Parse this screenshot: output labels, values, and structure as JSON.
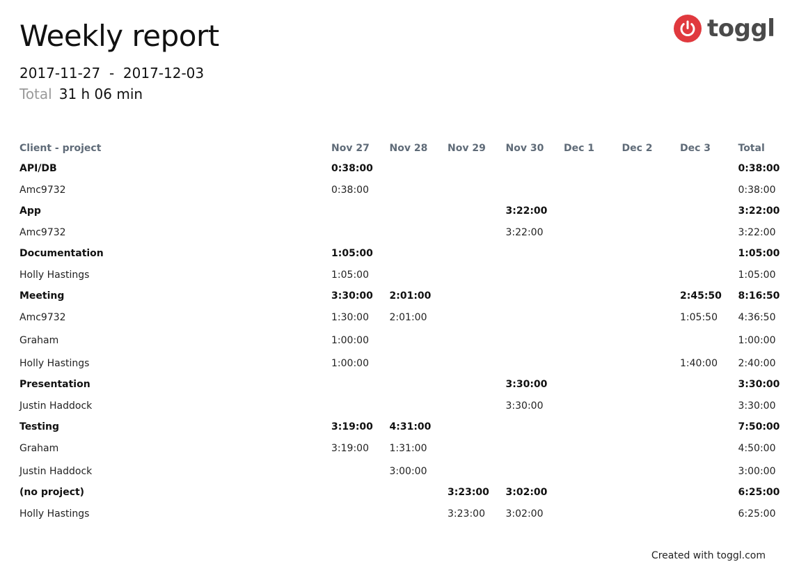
{
  "header": {
    "title": "Weekly report",
    "date_start": "2017-11-27",
    "date_separator": "-",
    "date_end": "2017-12-03",
    "total_label": "Total",
    "total_value": "31 h 06 min"
  },
  "brand": {
    "name": "toggl",
    "icon": "power-icon",
    "color": "#e0393e"
  },
  "table": {
    "columns": [
      "Client - project",
      "Nov 27",
      "Nov 28",
      "Nov 29",
      "Nov 30",
      "Dec 1",
      "Dec 2",
      "Dec 3",
      "Total"
    ],
    "rows": [
      {
        "type": "group",
        "cells": [
          "API/DB",
          "0:38:00",
          "",
          "",
          "",
          "",
          "",
          "",
          "0:38:00"
        ]
      },
      {
        "type": "sub",
        "cells": [
          "Amc9732",
          "0:38:00",
          "",
          "",
          "",
          "",
          "",
          "",
          "0:38:00"
        ]
      },
      {
        "type": "group",
        "cells": [
          "App",
          "",
          "",
          "",
          "3:22:00",
          "",
          "",
          "",
          "3:22:00"
        ]
      },
      {
        "type": "sub",
        "cells": [
          "Amc9732",
          "",
          "",
          "",
          "3:22:00",
          "",
          "",
          "",
          "3:22:00"
        ]
      },
      {
        "type": "group",
        "cells": [
          "Documentation",
          "1:05:00",
          "",
          "",
          "",
          "",
          "",
          "",
          "1:05:00"
        ]
      },
      {
        "type": "sub",
        "cells": [
          "Holly Hastings",
          "1:05:00",
          "",
          "",
          "",
          "",
          "",
          "",
          "1:05:00"
        ]
      },
      {
        "type": "group",
        "cells": [
          "Meeting",
          "3:30:00",
          "2:01:00",
          "",
          "",
          "",
          "",
          "2:45:50",
          "8:16:50"
        ]
      },
      {
        "type": "sub",
        "cells": [
          "Amc9732",
          "1:30:00",
          "2:01:00",
          "",
          "",
          "",
          "",
          "1:05:50",
          "4:36:50"
        ]
      },
      {
        "type": "sub",
        "cells": [
          "Graham",
          "1:00:00",
          "",
          "",
          "",
          "",
          "",
          "",
          "1:00:00"
        ]
      },
      {
        "type": "sub",
        "cells": [
          "Holly Hastings",
          "1:00:00",
          "",
          "",
          "",
          "",
          "",
          "1:40:00",
          "2:40:00"
        ]
      },
      {
        "type": "group",
        "cells": [
          "Presentation",
          "",
          "",
          "",
          "3:30:00",
          "",
          "",
          "",
          "3:30:00"
        ]
      },
      {
        "type": "sub",
        "cells": [
          "Justin Haddock",
          "",
          "",
          "",
          "3:30:00",
          "",
          "",
          "",
          "3:30:00"
        ]
      },
      {
        "type": "group",
        "cells": [
          "Testing",
          "3:19:00",
          "4:31:00",
          "",
          "",
          "",
          "",
          "",
          "7:50:00"
        ]
      },
      {
        "type": "sub",
        "cells": [
          "Graham",
          "3:19:00",
          "1:31:00",
          "",
          "",
          "",
          "",
          "",
          "4:50:00"
        ]
      },
      {
        "type": "sub",
        "cells": [
          "Justin Haddock",
          "",
          "3:00:00",
          "",
          "",
          "",
          "",
          "",
          "3:00:00"
        ]
      },
      {
        "type": "group",
        "cells": [
          "(no project)",
          "",
          "",
          "3:23:00",
          "3:02:00",
          "",
          "",
          "",
          "6:25:00"
        ]
      },
      {
        "type": "sub",
        "cells": [
          "Holly Hastings",
          "",
          "",
          "3:23:00",
          "3:02:00",
          "",
          "",
          "",
          "6:25:00"
        ]
      }
    ]
  },
  "footer": {
    "text": "Created with toggl.com"
  }
}
